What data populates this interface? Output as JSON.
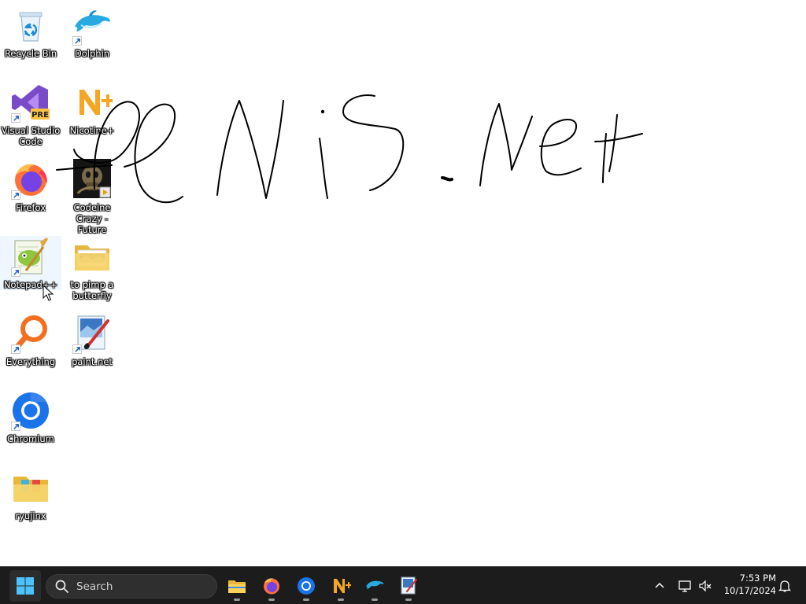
{
  "desktop": {
    "scribble_text": "PeNiS.Net",
    "icons": [
      {
        "label": "Recycle Bin",
        "icon": "recycle-bin-icon"
      },
      {
        "label": "Dolphin",
        "icon": "dolphin-icon"
      },
      {
        "label": "Visual Studio Code",
        "icon": "visual-studio-code-icon",
        "badge": "PRE"
      },
      {
        "label": "Nicotine+",
        "icon": "nicotine-icon"
      },
      {
        "label": "Firefox",
        "icon": "firefox-icon"
      },
      {
        "label": "Codeine Crazy - Future",
        "icon": "music-file-icon"
      },
      {
        "label": "Notepad++",
        "icon": "notepad-plus-plus-icon"
      },
      {
        "label": "to pimp a butterfly",
        "icon": "folder-icon"
      },
      {
        "label": "Everything",
        "icon": "everything-search-icon"
      },
      {
        "label": "paint.net",
        "icon": "paint-net-icon"
      },
      {
        "label": "Chromium",
        "icon": "chromium-icon"
      },
      {
        "label": "ryujinx",
        "icon": "folder-icon"
      }
    ]
  },
  "taskbar": {
    "search_placeholder": "Search",
    "pinned": [
      {
        "name": "file-explorer",
        "icon": "folder-icon"
      },
      {
        "name": "firefox",
        "icon": "firefox-icon"
      },
      {
        "name": "chromium",
        "icon": "chromium-icon"
      },
      {
        "name": "nicotine",
        "icon": "nicotine-icon"
      },
      {
        "name": "dolphin",
        "icon": "dolphin-icon"
      },
      {
        "name": "paint-net",
        "icon": "paint-net-icon"
      }
    ],
    "clock": {
      "time": "7:53 PM",
      "date": "10/17/2024"
    },
    "colors": {
      "taskbar_bg": "#1c1c1c",
      "windows_blue": "#0078d4"
    }
  }
}
